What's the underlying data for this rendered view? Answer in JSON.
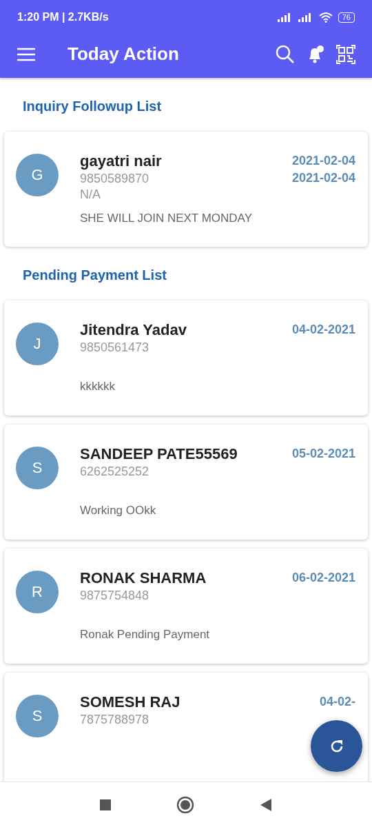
{
  "status_bar": {
    "time": "1:20 PM | 2.7KB/s",
    "battery": "76"
  },
  "app_bar": {
    "title": "Today Action"
  },
  "sections": [
    {
      "title": "Inquiry Followup List",
      "items": [
        {
          "initial": "G",
          "name": "gayatri nair",
          "phone": "9850589870",
          "detail": "N/A",
          "note": "SHE WILL JOIN NEXT MONDAY",
          "dates": [
            "2021-02-04",
            "2021-02-04"
          ]
        }
      ]
    },
    {
      "title": "Pending Payment List",
      "items": [
        {
          "initial": "J",
          "name": "Jitendra Yadav",
          "phone": "9850561473",
          "note": "kkkkkk",
          "dates": [
            "04-02-2021"
          ]
        },
        {
          "initial": "S",
          "name": "SANDEEP PATE55569",
          "phone": "6262525252",
          "note": "Working OOkk",
          "dates": [
            "05-02-2021"
          ]
        },
        {
          "initial": "R",
          "name": "RONAK SHARMA",
          "phone": "9875754848",
          "note": "Ronak Pending Payment",
          "dates": [
            "06-02-2021"
          ]
        },
        {
          "initial": "S",
          "name": "SOMESH RAJ",
          "phone": "7875788978",
          "dates": [
            "04-02-"
          ]
        }
      ]
    }
  ]
}
